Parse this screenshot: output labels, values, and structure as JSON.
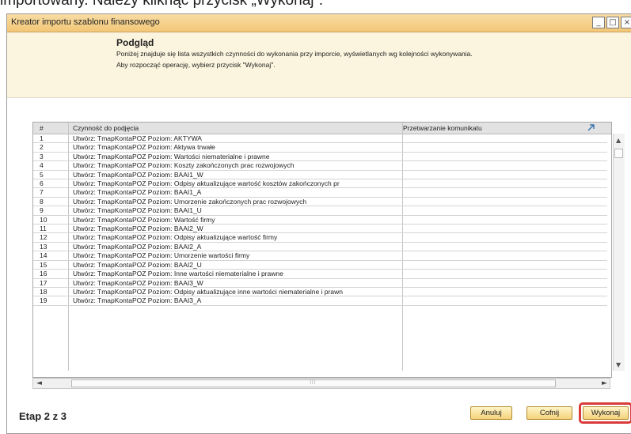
{
  "document": {
    "text": "importowany. Należy kliknąć przycisk „Wykonaj”."
  },
  "window": {
    "title": "Kreator importu szablonu finansowego",
    "controls": {
      "minimize": "_",
      "maximize": "□",
      "close": "×"
    }
  },
  "header": {
    "title": "Podgląd",
    "line1": "Poniżej znajduje się lista wszystkich czynności do wykonania przy imporcie, wyświetlanych wg kolejności wykonywania.",
    "line2": "Aby rozpocząć operację, wybierz przycisk \"Wykonaj\"."
  },
  "table": {
    "columns": [
      "#",
      "Czynność do podjęcia",
      "Przetwarzanie komunikatu"
    ],
    "rows": [
      {
        "num": "1",
        "action": "Utwórz: TmapKontaPOZ Poziom: AKTYWA",
        "message": ""
      },
      {
        "num": "2",
        "action": "Utwórz: TmapKontaPOZ Poziom: Aktywa trwałe",
        "message": ""
      },
      {
        "num": "3",
        "action": "Utwórz: TmapKontaPOZ Poziom: Wartości niematerialne i prawne",
        "message": ""
      },
      {
        "num": "4",
        "action": "Utwórz: TmapKontaPOZ Poziom: Koszty zakończonych prac rozwojowych",
        "message": ""
      },
      {
        "num": "5",
        "action": "Utwórz: TmapKontaPOZ Poziom: BAAI1_W",
        "message": ""
      },
      {
        "num": "6",
        "action": "Utwórz: TmapKontaPOZ Poziom: Odpisy aktualizujące wartość kosztów zakończonych pr",
        "message": ""
      },
      {
        "num": "7",
        "action": "Utwórz: TmapKontaPOZ Poziom: BAAI1_A",
        "message": ""
      },
      {
        "num": "8",
        "action": "Utwórz: TmapKontaPOZ Poziom: Umorzenie zakończonych prac rozwojowych",
        "message": ""
      },
      {
        "num": "9",
        "action": "Utwórz: TmapKontaPOZ Poziom: BAAI1_U",
        "message": ""
      },
      {
        "num": "10",
        "action": "Utwórz: TmapKontaPOZ Poziom: Wartość firmy",
        "message": ""
      },
      {
        "num": "11",
        "action": "Utwórz: TmapKontaPOZ Poziom: BAAI2_W",
        "message": ""
      },
      {
        "num": "12",
        "action": "Utwórz: TmapKontaPOZ Poziom: Odpisy aktualizujące wartość firmy",
        "message": ""
      },
      {
        "num": "13",
        "action": "Utwórz: TmapKontaPOZ Poziom: BAAI2_A",
        "message": ""
      },
      {
        "num": "14",
        "action": "Utwórz: TmapKontaPOZ Poziom: Umorzenie wartości firmy",
        "message": ""
      },
      {
        "num": "15",
        "action": "Utwórz: TmapKontaPOZ Poziom: BAAI2_U",
        "message": ""
      },
      {
        "num": "16",
        "action": "Utwórz: TmapKontaPOZ Poziom: Inne wartości niematerialne i prawne",
        "message": ""
      },
      {
        "num": "17",
        "action": "Utwórz: TmapKontaPOZ Poziom: BAAI3_W",
        "message": ""
      },
      {
        "num": "18",
        "action": "Utwórz: TmapKontaPOZ Poziom: Odpisy aktualizujące inne wartości niematerialne i prawn",
        "message": ""
      },
      {
        "num": "19",
        "action": "Utwórz: TmapKontaPOZ Poziom: BAAI3_A",
        "message": ""
      }
    ]
  },
  "scrollbar": {
    "up": "▲",
    "down": "▼",
    "left": "◄",
    "right": "►",
    "grip": "⁝⁝⁝"
  },
  "footer": {
    "step": "Etap 2 z 3",
    "buttons": {
      "cancel": "Anuluj",
      "back": "Cofnij",
      "execute": "Wykonaj"
    }
  },
  "colors": {
    "title_bar": "#f3c777",
    "header_bg": "#fbf4de",
    "button_bg": "#f4d27a",
    "highlight": "#d93a3a"
  },
  "icons": {
    "expand": "expand-arrow-icon"
  }
}
